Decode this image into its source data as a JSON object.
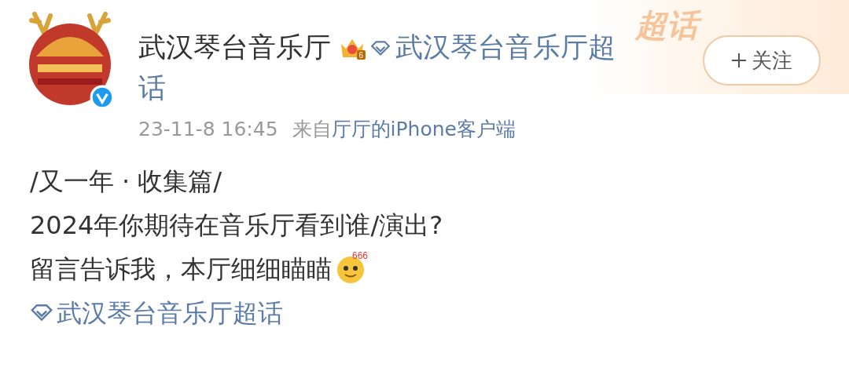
{
  "banner_text": "超话",
  "post": {
    "author": "武汉琴台音乐厅",
    "crown_level": "6",
    "verified": true,
    "supertopic_link_lines": [
      "武汉琴台音乐厅超",
      "话"
    ],
    "time": "23-11-8 16:45",
    "source_prefix": "来自",
    "source": "厅厅的iPhone客户端"
  },
  "follow_button": {
    "label": "关注"
  },
  "body": {
    "lines": [
      "/又一年 · 收集篇/",
      "2024年你期待在音乐厅看到谁/演出?",
      "留言告诉我，本厅细细瞄瞄"
    ],
    "emoji_label": "666",
    "topic_link": "武汉琴台音乐厅超话"
  }
}
